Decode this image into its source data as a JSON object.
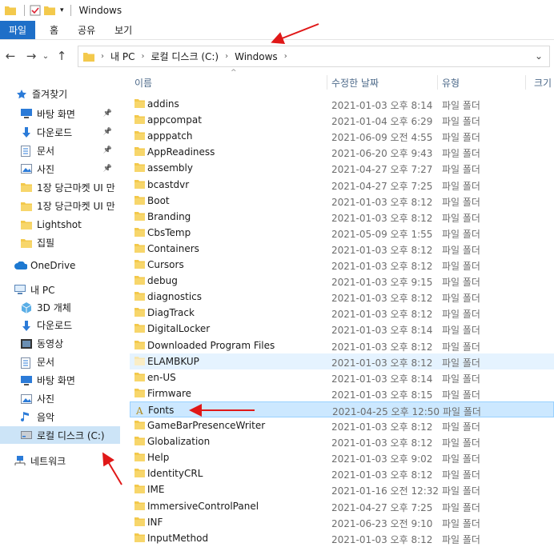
{
  "window": {
    "title": "Windows"
  },
  "ribbon": {
    "tabs": [
      "파일",
      "홈",
      "공유",
      "보기"
    ]
  },
  "address": {
    "crumbs": [
      "내 PC",
      "로컬 디스크 (C:)",
      "Windows"
    ]
  },
  "columns": {
    "name": "이름",
    "modified": "수정한 날짜",
    "type": "유형",
    "size": "크기"
  },
  "sidebar": {
    "quick_access": "즐겨찾기",
    "quick_items": [
      {
        "label": "바탕 화면",
        "icon": "desktop-icon",
        "pinned": true
      },
      {
        "label": "다운로드",
        "icon": "download-icon",
        "pinned": true
      },
      {
        "label": "문서",
        "icon": "document-icon",
        "pinned": true
      },
      {
        "label": "사진",
        "icon": "pictures-icon",
        "pinned": true
      },
      {
        "label": "1장 당근마켓 UI 만",
        "icon": "folder-icon",
        "pinned": false
      },
      {
        "label": "1장 당근마켓 UI 만",
        "icon": "folder-icon",
        "pinned": false
      },
      {
        "label": "Lightshot",
        "icon": "folder-icon",
        "pinned": false
      },
      {
        "label": "집필",
        "icon": "folder-icon",
        "pinned": false
      }
    ],
    "onedrive": "OneDrive",
    "this_pc": "내 PC",
    "pc_items": [
      {
        "label": "3D 개체",
        "icon": "3d-objects-icon"
      },
      {
        "label": "다운로드",
        "icon": "download-icon"
      },
      {
        "label": "동영상",
        "icon": "video-icon"
      },
      {
        "label": "문서",
        "icon": "document-icon"
      },
      {
        "label": "바탕 화면",
        "icon": "desktop-icon"
      },
      {
        "label": "사진",
        "icon": "pictures-icon"
      },
      {
        "label": "음악",
        "icon": "music-icon"
      },
      {
        "label": "로컬 디스크 (C:)",
        "icon": "drive-icon"
      }
    ],
    "network": "네트워크"
  },
  "files": [
    {
      "name": "addins",
      "date": "2021-01-03 오후 8:14",
      "type": "파일 폴더"
    },
    {
      "name": "appcompat",
      "date": "2021-01-04 오후 6:29",
      "type": "파일 폴더"
    },
    {
      "name": "apppatch",
      "date": "2021-06-09 오전 4:55",
      "type": "파일 폴더"
    },
    {
      "name": "AppReadiness",
      "date": "2021-06-20 오후 9:43",
      "type": "파일 폴더"
    },
    {
      "name": "assembly",
      "date": "2021-04-27 오후 7:27",
      "type": "파일 폴더"
    },
    {
      "name": "bcastdvr",
      "date": "2021-04-27 오후 7:25",
      "type": "파일 폴더"
    },
    {
      "name": "Boot",
      "date": "2021-01-03 오후 8:12",
      "type": "파일 폴더"
    },
    {
      "name": "Branding",
      "date": "2021-01-03 오후 8:12",
      "type": "파일 폴더"
    },
    {
      "name": "CbsTemp",
      "date": "2021-05-09 오후 1:55",
      "type": "파일 폴더"
    },
    {
      "name": "Containers",
      "date": "2021-01-03 오후 8:12",
      "type": "파일 폴더"
    },
    {
      "name": "Cursors",
      "date": "2021-01-03 오후 8:12",
      "type": "파일 폴더"
    },
    {
      "name": "debug",
      "date": "2021-01-03 오후 9:15",
      "type": "파일 폴더"
    },
    {
      "name": "diagnostics",
      "date": "2021-01-03 오후 8:12",
      "type": "파일 폴더"
    },
    {
      "name": "DiagTrack",
      "date": "2021-01-03 오후 8:12",
      "type": "파일 폴더"
    },
    {
      "name": "DigitalLocker",
      "date": "2021-01-03 오후 8:14",
      "type": "파일 폴더"
    },
    {
      "name": "Downloaded Program Files",
      "date": "2021-01-03 오후 8:12",
      "type": "파일 폴더"
    },
    {
      "name": "ELAMBKUP",
      "date": "2021-01-03 오후 8:12",
      "type": "파일 폴더"
    },
    {
      "name": "en-US",
      "date": "2021-01-03 오후 8:14",
      "type": "파일 폴더"
    },
    {
      "name": "Firmware",
      "date": "2021-01-03 오후 8:15",
      "type": "파일 폴더"
    },
    {
      "name": "Fonts",
      "date": "2021-04-25 오후 12:50",
      "type": "파일 폴더"
    },
    {
      "name": "GameBarPresenceWriter",
      "date": "2021-01-03 오후 8:12",
      "type": "파일 폴더"
    },
    {
      "name": "Globalization",
      "date": "2021-01-03 오후 8:12",
      "type": "파일 폴더"
    },
    {
      "name": "Help",
      "date": "2021-01-03 오후 9:02",
      "type": "파일 폴더"
    },
    {
      "name": "IdentityCRL",
      "date": "2021-01-03 오후 8:12",
      "type": "파일 폴더"
    },
    {
      "name": "IME",
      "date": "2021-01-16 오전 12:32",
      "type": "파일 폴더"
    },
    {
      "name": "ImmersiveControlPanel",
      "date": "2021-04-27 오후 7:25",
      "type": "파일 폴더"
    },
    {
      "name": "INF",
      "date": "2021-06-23 오전 9:10",
      "type": "파일 폴더"
    },
    {
      "name": "InputMethod",
      "date": "2021-01-03 오후 8:12",
      "type": "파일 폴더"
    }
  ],
  "colors": {
    "accent": "#1e6fc8",
    "folder": "#f3c94c",
    "selection": "#cce8ff",
    "annotation": "#e01818"
  }
}
